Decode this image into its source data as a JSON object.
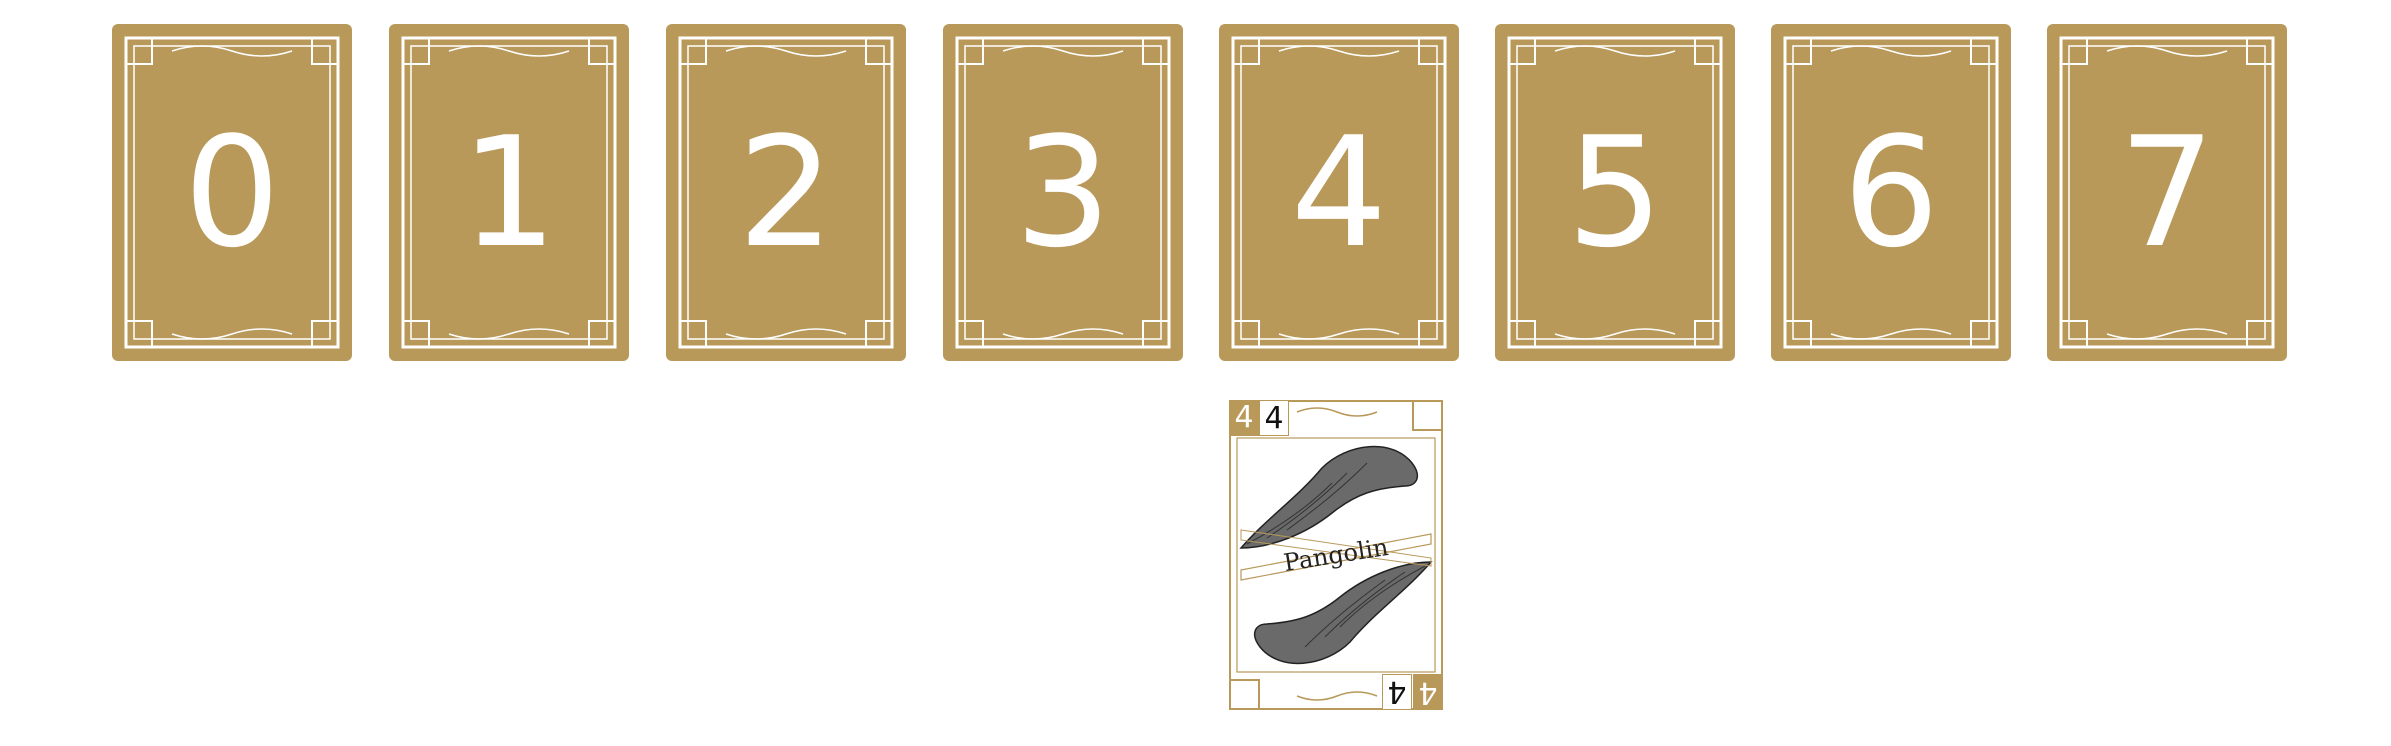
{
  "deck": {
    "cards": [
      {
        "label": "0"
      },
      {
        "label": "1"
      },
      {
        "label": "2"
      },
      {
        "label": "3"
      },
      {
        "label": "4"
      },
      {
        "label": "5"
      },
      {
        "label": "6"
      },
      {
        "label": "7"
      }
    ]
  },
  "played_card": {
    "name": "Pangolin",
    "value": "4",
    "illustration": "pangolin"
  },
  "colors": {
    "card_gold": "#b8995a",
    "card_border": "#ffffff",
    "text_dark": "#222222"
  }
}
